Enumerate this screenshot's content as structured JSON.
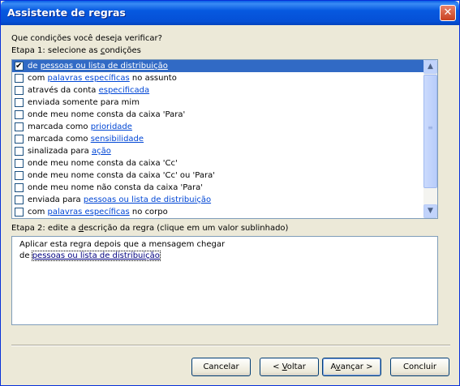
{
  "window": {
    "title": "Assistente de regras",
    "close_glyph": "✕"
  },
  "prompt": "Que condições você deseja verificar?",
  "step1_label": {
    "before": "Etapa 1: selecione as ",
    "mnemonic": "c",
    "after": "ondições"
  },
  "conditions": [
    {
      "checked": true,
      "selected": true,
      "parts": [
        {
          "t": "de "
        },
        {
          "t": "pessoas ou lista de distribuição",
          "link": true
        }
      ]
    },
    {
      "checked": false,
      "selected": false,
      "parts": [
        {
          "t": "com "
        },
        {
          "t": "palavras específicas",
          "link": true
        },
        {
          "t": " no assunto"
        }
      ]
    },
    {
      "checked": false,
      "selected": false,
      "parts": [
        {
          "t": "através da conta "
        },
        {
          "t": "especificada",
          "link": true
        }
      ]
    },
    {
      "checked": false,
      "selected": false,
      "parts": [
        {
          "t": "enviada somente para mim"
        }
      ]
    },
    {
      "checked": false,
      "selected": false,
      "parts": [
        {
          "t": "onde meu nome consta da caixa 'Para'"
        }
      ]
    },
    {
      "checked": false,
      "selected": false,
      "parts": [
        {
          "t": "marcada como "
        },
        {
          "t": "prioridade",
          "link": true
        }
      ]
    },
    {
      "checked": false,
      "selected": false,
      "parts": [
        {
          "t": "marcada como "
        },
        {
          "t": "sensibilidade",
          "link": true
        }
      ]
    },
    {
      "checked": false,
      "selected": false,
      "parts": [
        {
          "t": "sinalizada para "
        },
        {
          "t": "ação",
          "link": true
        }
      ]
    },
    {
      "checked": false,
      "selected": false,
      "parts": [
        {
          "t": "onde meu nome consta da caixa 'Cc'"
        }
      ]
    },
    {
      "checked": false,
      "selected": false,
      "parts": [
        {
          "t": "onde meu nome consta da caixa 'Cc' ou 'Para'"
        }
      ]
    },
    {
      "checked": false,
      "selected": false,
      "parts": [
        {
          "t": "onde meu nome não consta da caixa 'Para'"
        }
      ]
    },
    {
      "checked": false,
      "selected": false,
      "parts": [
        {
          "t": "enviada para "
        },
        {
          "t": "pessoas ou lista de distribuição",
          "link": true
        }
      ]
    },
    {
      "checked": false,
      "selected": false,
      "parts": [
        {
          "t": "com "
        },
        {
          "t": "palavras específicas",
          "link": true
        },
        {
          "t": " no corpo"
        }
      ]
    }
  ],
  "scrollbar": {
    "up_glyph": "▲",
    "down_glyph": "▼",
    "grip_glyph": "≡"
  },
  "step2_label": {
    "before": "Etapa 2: edite a ",
    "mnemonic": "d",
    "after": "escrição da regra (clique em um valor sublinhado)"
  },
  "description": {
    "line1": "Aplicar esta regra depois que a mensagem chegar",
    "line2_prefix": "de ",
    "line2_link": "pessoas ou lista de distribuição"
  },
  "buttons": {
    "cancel": "Cancelar",
    "back": {
      "before": "< ",
      "mnemonic": "V",
      "after": "oltar"
    },
    "next": {
      "before": "A",
      "mnemonic": "v",
      "after": "ançar >"
    },
    "finish": "Concluir"
  }
}
